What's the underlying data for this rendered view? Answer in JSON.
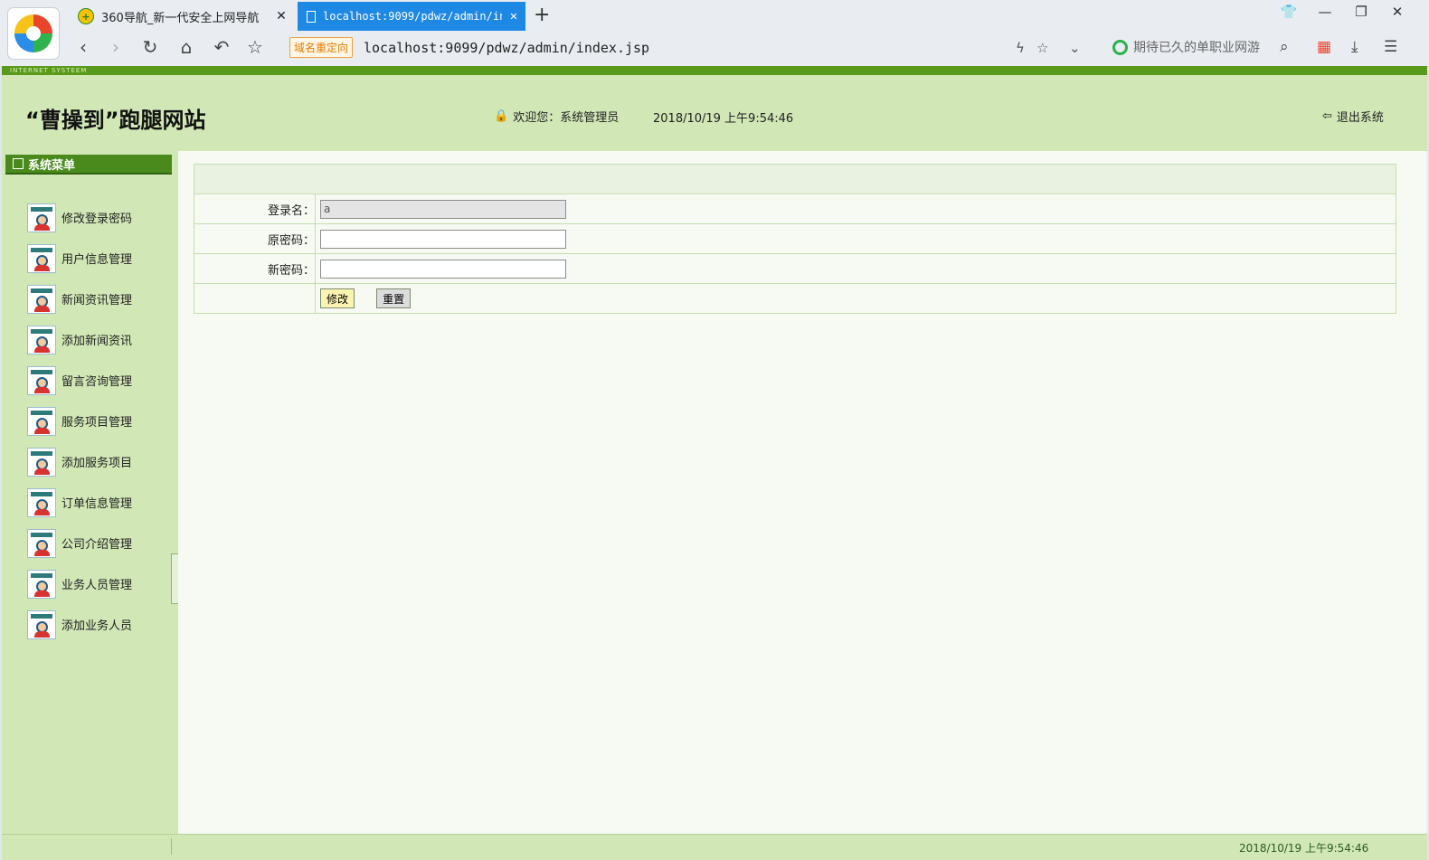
{
  "browser": {
    "tabs": [
      {
        "title": "360导航_新一代安全上网导航",
        "active": false
      },
      {
        "title": "localhost:9099/pdwz/admin/in",
        "active": true
      }
    ],
    "redirect_badge": "域名重定向",
    "url": "localhost:9099/pdwz/admin/index.jsp",
    "search_hint": "期待已久的单职业网游"
  },
  "page": {
    "banner_text": "INTERNET SYSTEEM",
    "site_title": "“曹操到”跑腿网站",
    "welcome": "欢迎您：系统管理员",
    "datetime": "2018/10/19 上午9:54:46",
    "logout": "退出系统"
  },
  "sidebar": {
    "title": "系统菜单",
    "items": [
      {
        "label": "修改登录密码"
      },
      {
        "label": "用户信息管理"
      },
      {
        "label": "新闻资讯管理"
      },
      {
        "label": "添加新闻资讯"
      },
      {
        "label": "留言咨询管理"
      },
      {
        "label": "服务项目管理"
      },
      {
        "label": "添加服务项目"
      },
      {
        "label": "订单信息管理"
      },
      {
        "label": "公司介绍管理"
      },
      {
        "label": "业务人员管理"
      },
      {
        "label": "添加业务人员"
      }
    ]
  },
  "form": {
    "login_label": "登录名：",
    "login_value": "a",
    "old_pwd_label": "原密码：",
    "old_pwd_value": "",
    "new_pwd_label": "新密码：",
    "new_pwd_value": "",
    "submit_label": "修改",
    "reset_label": "重置"
  },
  "statusbar": {
    "time": "2018/10/19 上午9:54:46"
  },
  "colors": {
    "header_bg": "#d1e7b6",
    "menu_head": "#4a8a1c",
    "active_tab": "#1e88e5"
  }
}
